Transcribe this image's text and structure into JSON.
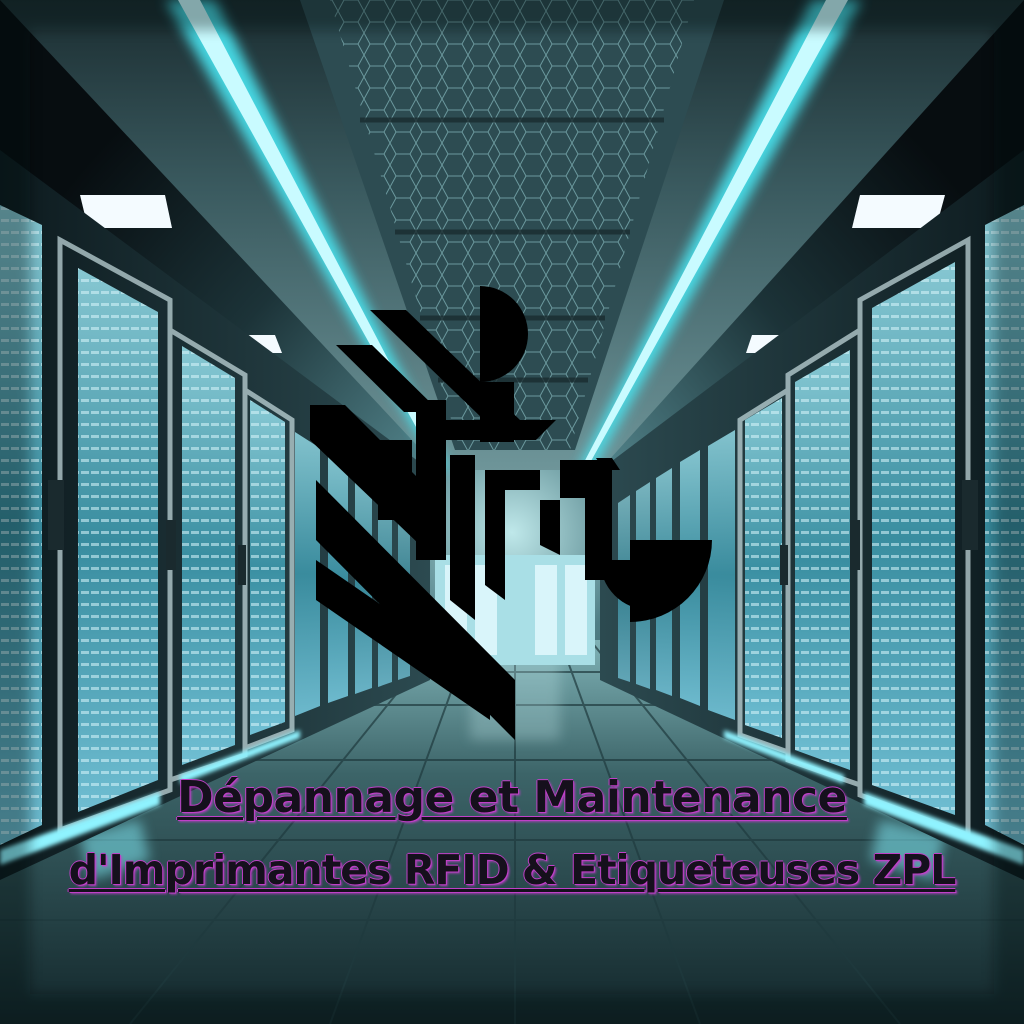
{
  "headline": {
    "line1": "Dépannage et Maintenance",
    "line2": "d'Imprimantes RFID & Etiqueteuses ZPL"
  },
  "palette": {
    "glow": "#49e6f2",
    "rack_light": "#7fd8ef",
    "ceiling": "#4e6e74",
    "floor": "#2a4a50",
    "logo": "#000000",
    "text": "#15101c",
    "text_outline": "#c040c8"
  },
  "icons": {
    "logo": "abstract-zebra-logo-icon"
  }
}
